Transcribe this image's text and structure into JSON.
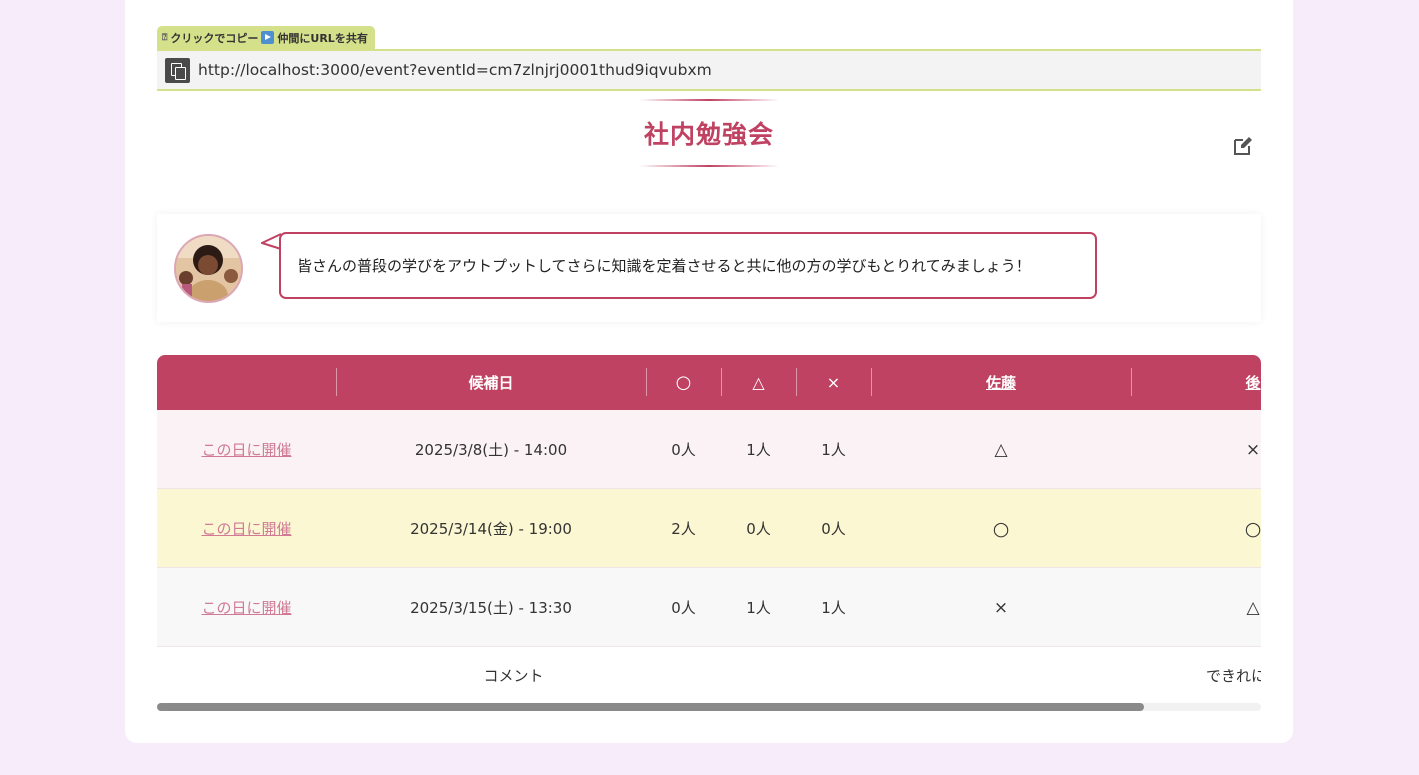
{
  "share": {
    "tag_icon": "⍰",
    "tag_label": "クリックでコピー",
    "tag_label_2": "仲間にURLを共有",
    "url": "http://localhost:3000/event?eventId=cm7zlnjrj0001thud9iqvubxm"
  },
  "event": {
    "title": "社内勉強会",
    "description": "皆さんの普段の学びをアウトプットしてさらに知識を定着させると共に他の方の学びもとりれてみましょう！"
  },
  "table": {
    "headers": {
      "candidate": "候補日",
      "ok": "○",
      "maybe": "△",
      "ng": "×",
      "participant_1": "佐藤",
      "participant_2": "後"
    },
    "rows": [
      {
        "action": "この日に開催",
        "date": "2025/3/8(土) - 14:00",
        "ok": "0人",
        "maybe": "1人",
        "ng": "1人",
        "p1": "△",
        "p2": "×"
      },
      {
        "action": "この日に開催",
        "date": "2025/3/14(金) - 19:00",
        "ok": "2人",
        "maybe": "0人",
        "ng": "0人",
        "p1": "○",
        "p2": "○"
      },
      {
        "action": "この日に開催",
        "date": "2025/3/15(土) - 13:30",
        "ok": "0人",
        "maybe": "1人",
        "ng": "1人",
        "p1": "×",
        "p2": "△"
      }
    ],
    "comment_label": "コメント",
    "comment_p2": "できれに"
  },
  "colors": {
    "accent": "#c04262",
    "highlight_row": "#fbf7d2",
    "share_tag": "#d4e08a",
    "background": "#f6ecfa"
  }
}
